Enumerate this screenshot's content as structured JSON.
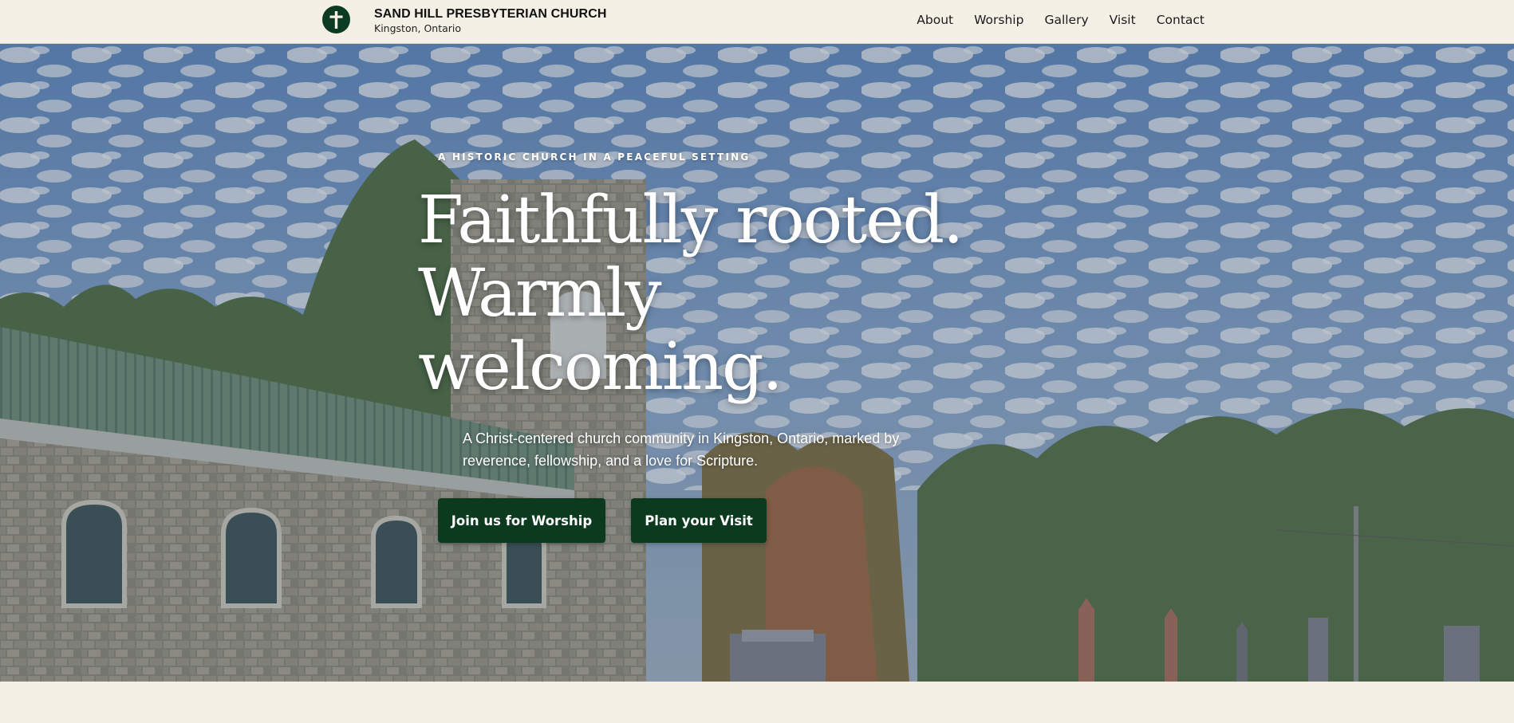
{
  "header": {
    "church_name": "SAND HILL PRESBYTERIAN CHURCH",
    "location": "Kingston, Ontario",
    "logo_icon": "cross-icon",
    "nav": [
      {
        "label": "About"
      },
      {
        "label": "Worship"
      },
      {
        "label": "Gallery"
      },
      {
        "label": "Visit"
      },
      {
        "label": "Contact"
      }
    ]
  },
  "hero": {
    "eyebrow": "A HISTORIC CHURCH IN A PEACEFUL SETTING",
    "headline_lines": [
      "Faithfully rooted.",
      "Warmly",
      "welcoming."
    ],
    "lede": "A Christ-centered church community in Kingston, Ontario, marked by reverence, fellowship, and a love for Scripture.",
    "primary_button": "Join us for Worship",
    "secondary_button": "Plan your Visit"
  },
  "colors": {
    "accent": "#0b3a1e",
    "page_background": "#f5f0e6",
    "text_dark": "#1b1b1b"
  }
}
